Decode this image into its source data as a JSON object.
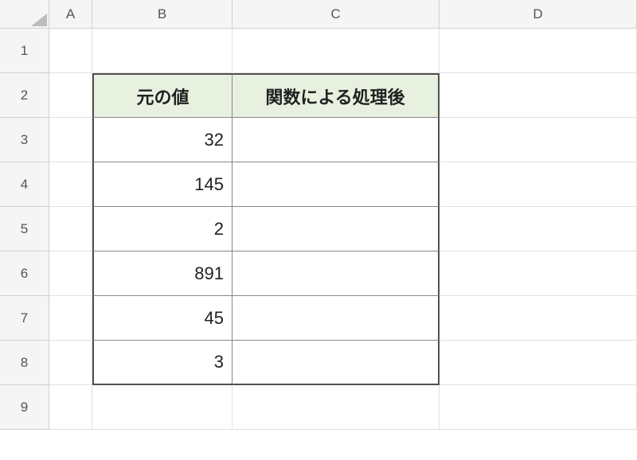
{
  "columns": [
    "A",
    "B",
    "C",
    "D"
  ],
  "rows": [
    "1",
    "2",
    "3",
    "4",
    "5",
    "6",
    "7",
    "8",
    "9"
  ],
  "table": {
    "headers": {
      "b2": "元の値",
      "c2": "関数による処理後"
    },
    "data": {
      "b3": "32",
      "b4": "145",
      "b5": "2",
      "b6": "891",
      "b7": "45",
      "b8": "3",
      "c3": "",
      "c4": "",
      "c5": "",
      "c6": "",
      "c7": "",
      "c8": ""
    }
  }
}
